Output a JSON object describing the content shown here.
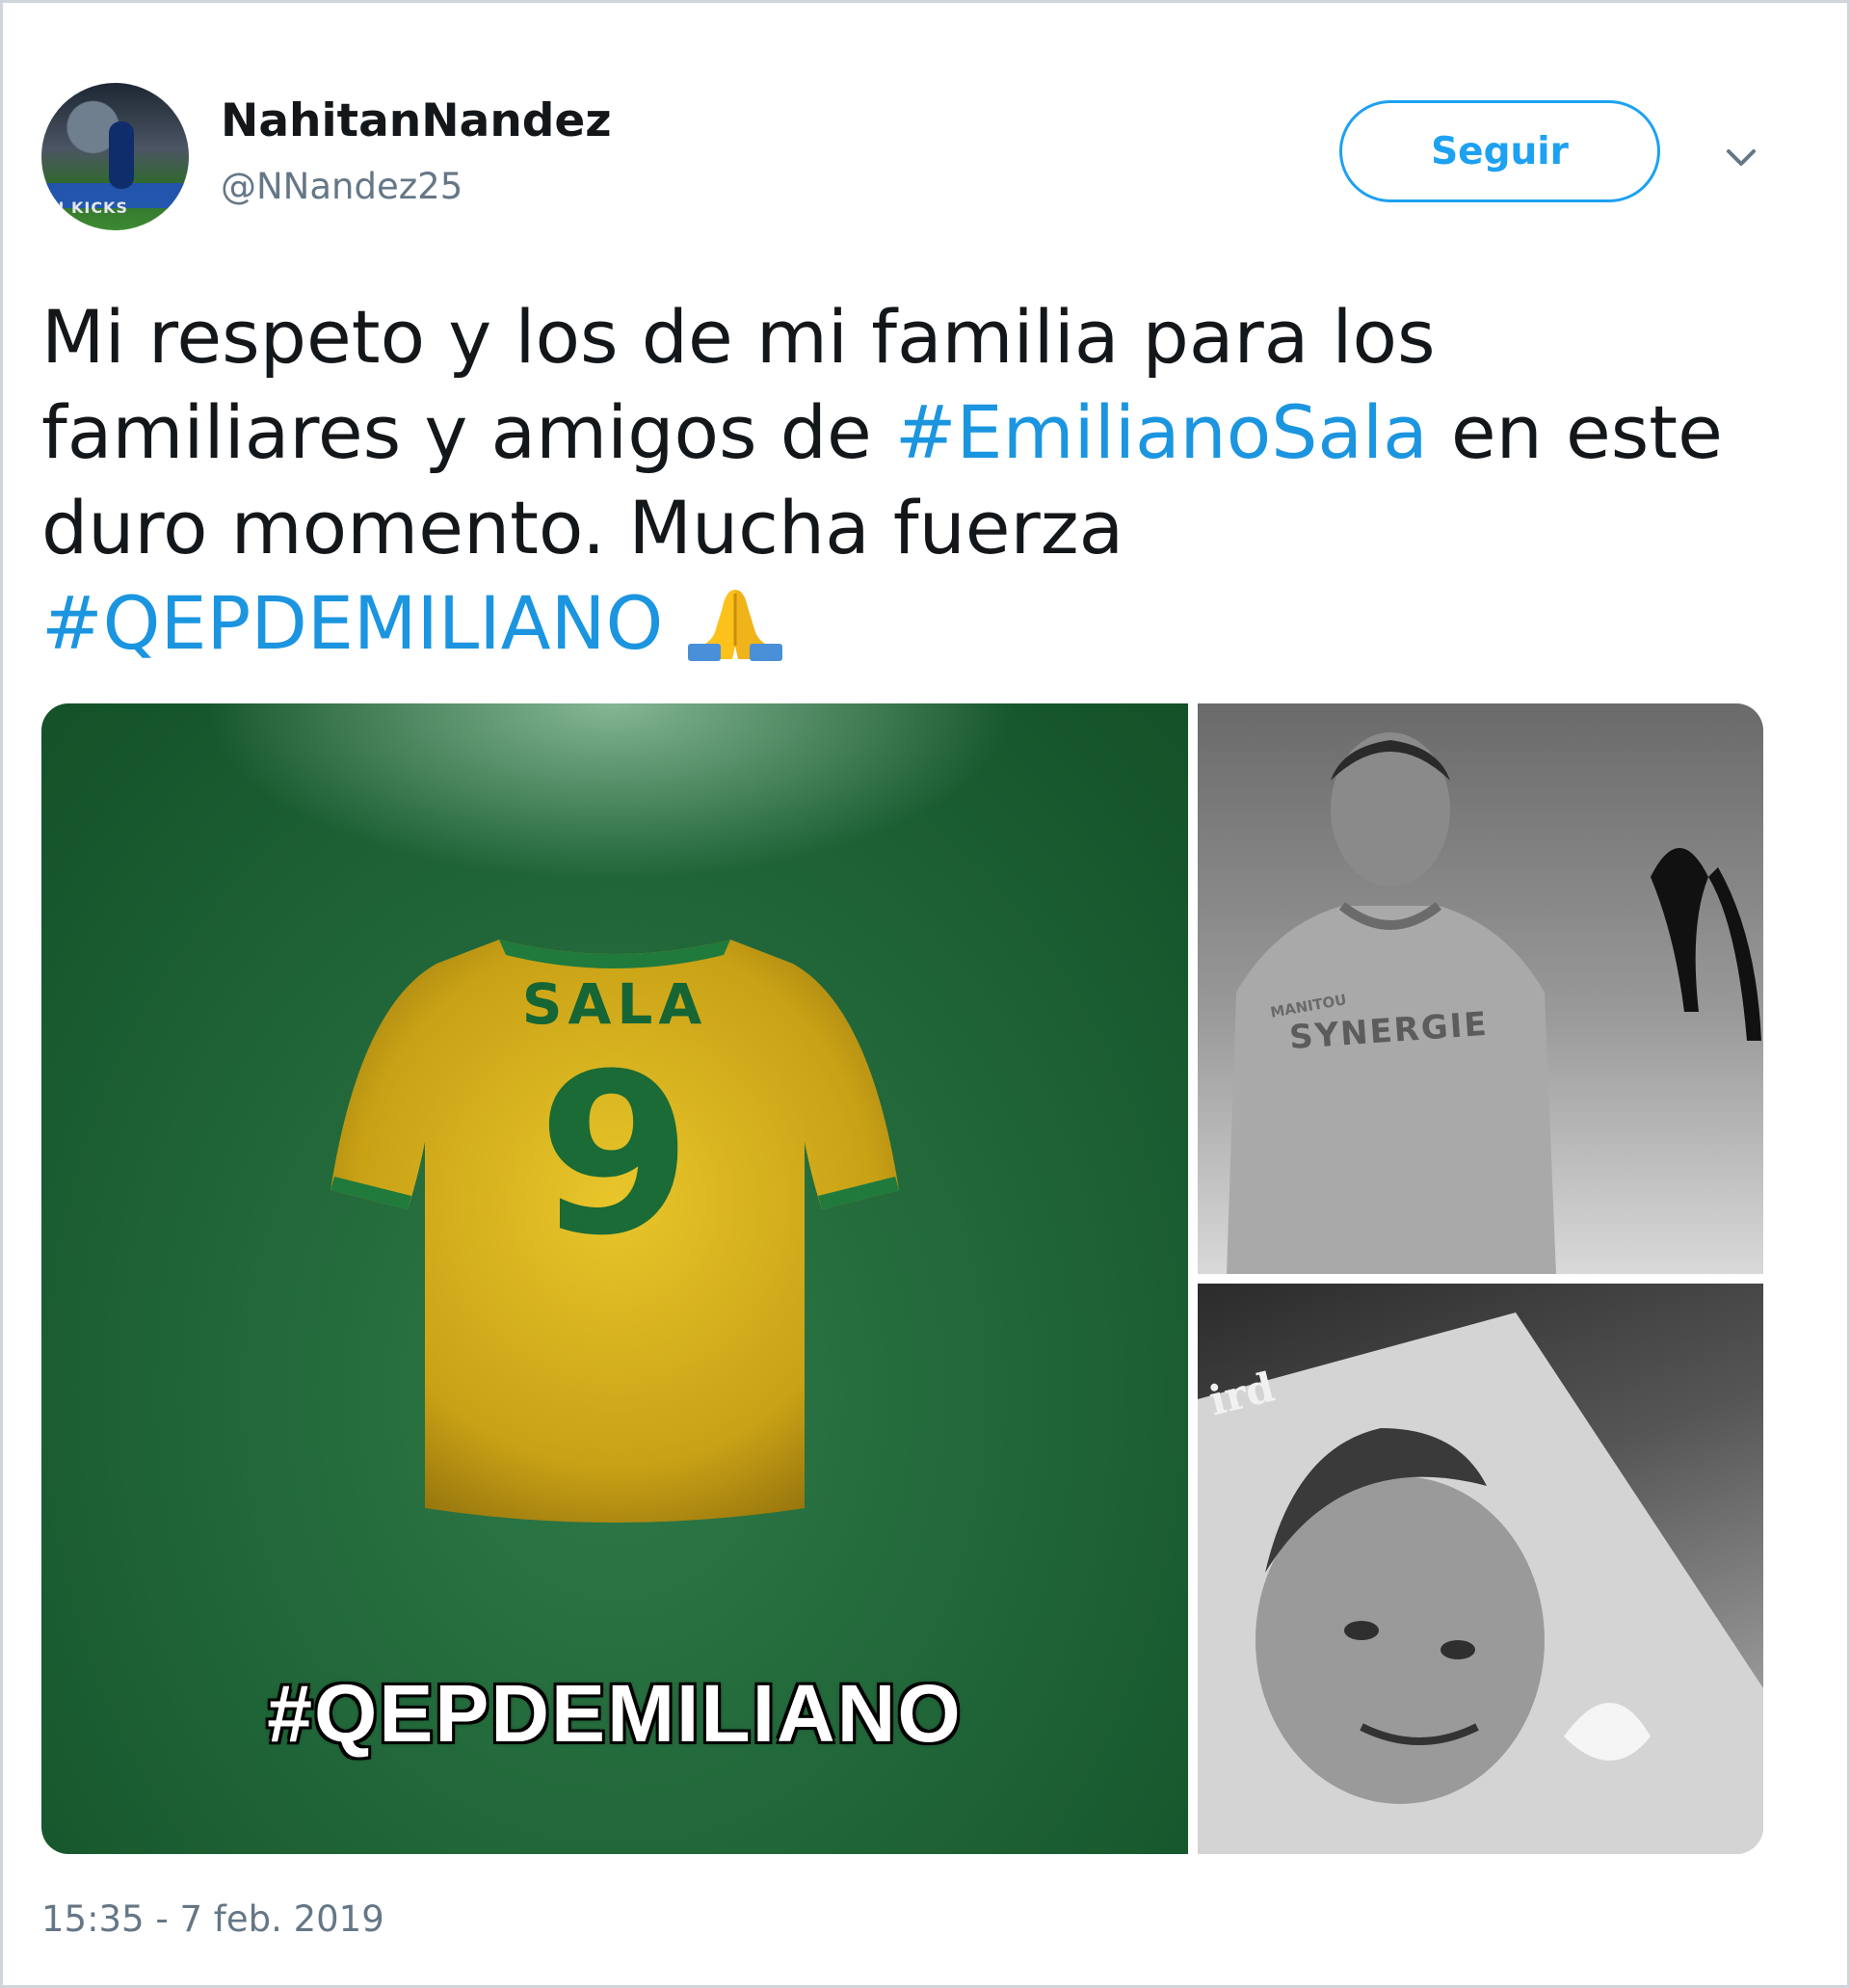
{
  "user": {
    "display_name": "NahitanNandez",
    "handle": "@NNandez25",
    "avatar_text": "N KICKS"
  },
  "actions": {
    "follow_label": "Seguir",
    "more_icon": "chevron-down-icon"
  },
  "tweet": {
    "line1": "Mi respeto y los de mi familia para los",
    "line2_pre": "familiares y amigos de ",
    "line2_tag": "#EmilianoSala",
    "line2_post": " en este",
    "line3": "duro momento. Mucha fuerza",
    "line4_tag": "#QEPDEMILIANO",
    "emoji": "folded-hands-icon"
  },
  "media": {
    "jersey_name": "SALA",
    "jersey_number": "9",
    "overlay_tag": "#QEPDEMILIANO",
    "shirt_sponsor": "SYNERGIE",
    "shirt_brand": "MANITOU",
    "magazine_fragment": "ird"
  },
  "timestamp": "15:35 - 7 feb. 2019",
  "colors": {
    "accent": "#1da1f2",
    "hashtag": "#1b95e0",
    "text": "#14171a",
    "muted": "#657786",
    "jersey_yellow": "#d4b21f",
    "jersey_green": "#1f6437"
  }
}
